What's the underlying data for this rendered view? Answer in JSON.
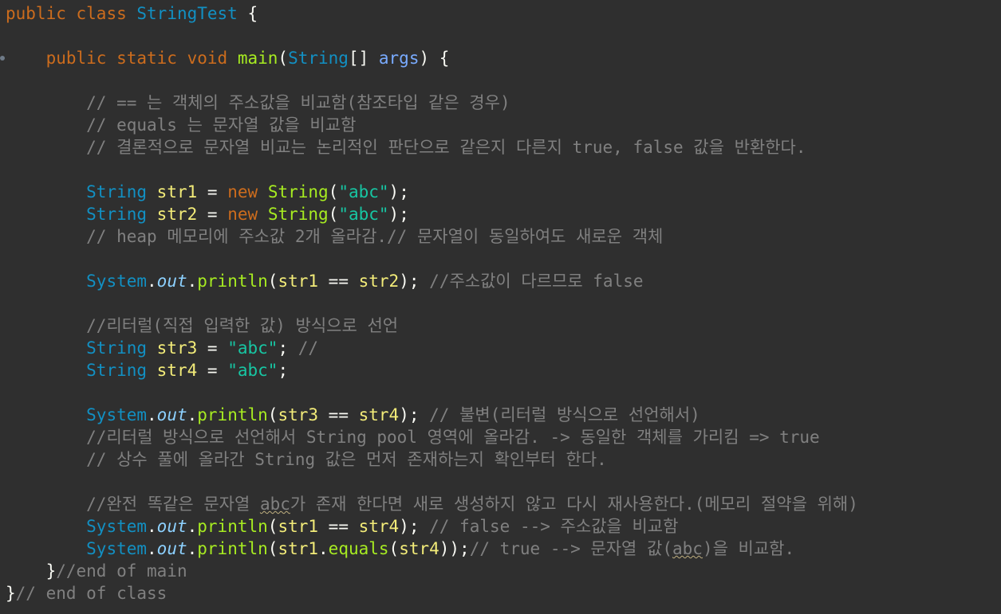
{
  "code": {
    "l1": {
      "a": "public",
      "b": "class",
      "c": "StringTest",
      "d": "{"
    },
    "l3": {
      "a": "public",
      "b": "static",
      "c": "void",
      "d": "main",
      "e": "(",
      "f": "String",
      "g": "[]",
      "h": "args",
      "i": ")",
      "j": "{"
    },
    "l5": "// == 는 객체의 주소값을 비교함(참조타입 같은 경우)",
    "l6": "// equals 는 문자열 값을 비교함",
    "l7": "// 결론적으로 문자열 비교는 논리적인 판단으로 같은지 다른지 true, false 값을 반환한다.",
    "l9": {
      "a": "String",
      "b": "str1",
      "c": "=",
      "d": "new",
      "e": "String",
      "f": "(",
      "g": "\"abc\"",
      "h": ");"
    },
    "l10": {
      "a": "String",
      "b": "str2",
      "c": "=",
      "d": "new",
      "e": "String",
      "f": "(",
      "g": "\"abc\"",
      "h": ");"
    },
    "l11": "// heap 메모리에 주소값 2개 올라감.// 문자열이 동일하여도 새로운 객체",
    "l13": {
      "a": "System",
      "b": ".",
      "c": "out",
      "d": ".",
      "e": "println",
      "f": "(",
      "g": "str1",
      "h": "==",
      "i": "str2",
      "j": ");",
      "k": "//주소값이 다르므로 false"
    },
    "l15": "//리터럴(직접 입력한 값) 방식으로 선언",
    "l16": {
      "a": "String",
      "b": "str3",
      "c": "=",
      "d": "\"abc\"",
      "e": ";",
      "f": "//"
    },
    "l17": {
      "a": "String",
      "b": "str4",
      "c": "=",
      "d": "\"abc\"",
      "e": ";"
    },
    "l19": {
      "a": "System",
      "b": ".",
      "c": "out",
      "d": ".",
      "e": "println",
      "f": "(",
      "g": "str3",
      "h": "==",
      "i": "str4",
      "j": ");",
      "k": "// 불변(리터럴 방식으로 선언해서)"
    },
    "l20": "//리터럴 방식으로 선언해서 String pool 영역에 올라감. -> 동일한 객체를 가리킴 => true",
    "l21": "// 상수 풀에 올라간 String 값은 먼저 존재하는지 확인부터 한다.",
    "l23": {
      "a": "//완전 똑같은 문자열 ",
      "b": "abc",
      "c": "가 존재 한다면 새로 생성하지 않고 다시 재사용한다.(메모리 절약을 위해)"
    },
    "l24": {
      "a": "System",
      "b": ".",
      "c": "out",
      "d": ".",
      "e": "println",
      "f": "(",
      "g": "str1",
      "h": "==",
      "i": "str4",
      "j": ");",
      "k": "// false --> 주소값을 비교함"
    },
    "l25": {
      "a": "System",
      "b": ".",
      "c": "out",
      "d": ".",
      "e": "println",
      "f": "(",
      "g": "str1",
      "h": ".",
      "i": "equals",
      "j": "(",
      "k": "str4",
      "l": "));",
      "m": "// true --> 문자열 값(",
      "n": "abc",
      "o": ")을 비교함."
    },
    "l26": {
      "a": "}",
      "b": "//end of main"
    },
    "l27": {
      "a": "}",
      "b": "// end of class"
    }
  },
  "colors": {
    "background": "#2f2f2f",
    "keyword": "#cc7832",
    "type": "#1290c3",
    "method": "#a7ec21",
    "variable": "#f3ec79",
    "string": "#17c6a3",
    "comment": "#808080",
    "field": "#8dd1ff"
  },
  "icons": {
    "gutter": "breakpoint-dot-icon"
  }
}
